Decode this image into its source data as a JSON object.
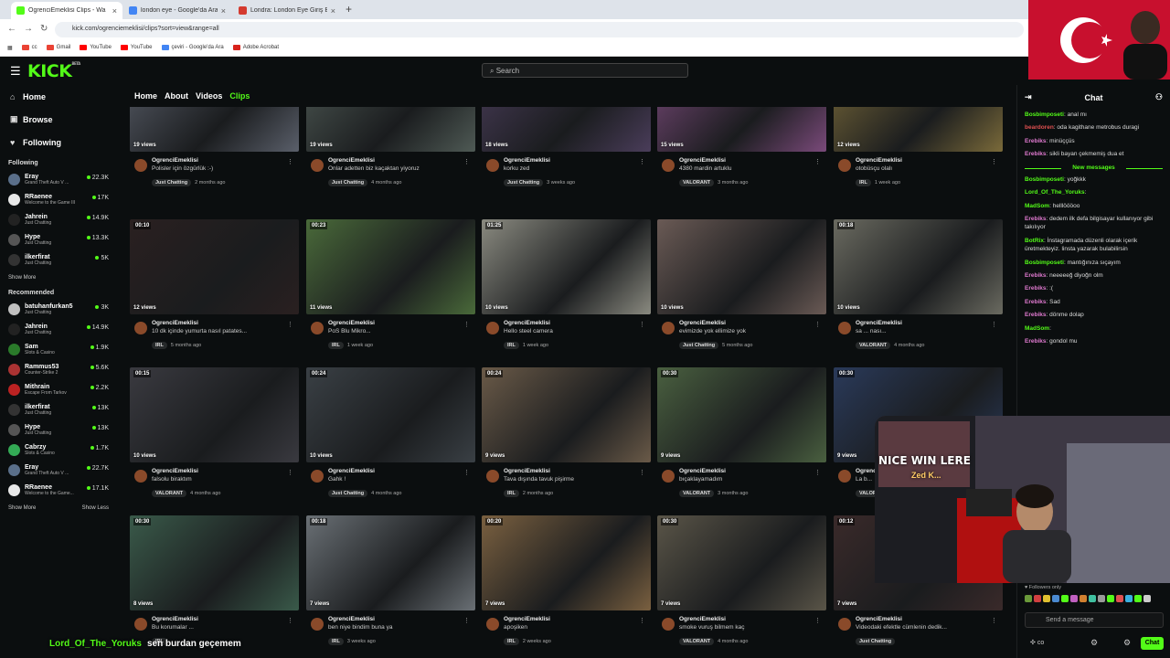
{
  "browser": {
    "tabs": [
      {
        "title": "OgrenciEmeklisi Clips - Wa",
        "color": "#53fc18",
        "active": true
      },
      {
        "title": "london eye - Google'da Ara",
        "color": "#4285f4",
        "active": false
      },
      {
        "title": "Londra: London Eye Giriş Bileti",
        "color": "#d43a2f",
        "active": false
      }
    ],
    "url": "kick.com/ogrenciemeklisi/clips?sort=view&range=all",
    "bookmarks": [
      {
        "label": "cc",
        "color": "#ea4335"
      },
      {
        "label": "Gmail",
        "color": "#ea4335"
      },
      {
        "label": "YouTube",
        "color": "#ff0000"
      },
      {
        "label": "YouTube",
        "color": "#ff0000"
      },
      {
        "label": "çeviri - Google'da Ara",
        "color": "#4285f4"
      },
      {
        "label": "Adobe Acrobat",
        "color": "#d8231c"
      }
    ]
  },
  "header": {
    "logo": "KICK",
    "logo_beta": "BETA",
    "search_placeholder": "Search"
  },
  "sidebar": {
    "nav": [
      {
        "icon": "⌂",
        "label": "Home"
      },
      {
        "icon": "▣",
        "label": "Browse"
      },
      {
        "icon": "♥",
        "label": "Following"
      }
    ],
    "following_title": "Following",
    "following": [
      {
        "name": "Eray",
        "game": "Grand Theft Auto V ...",
        "viewers": "22.3K",
        "color": "#5a6f8a"
      },
      {
        "name": "RRaenee",
        "game": "Welcome to the Game III",
        "viewers": "17K",
        "color": "#e8e8e8"
      },
      {
        "name": "Jahrein",
        "game": "Just Chatting",
        "viewers": "14.9K",
        "color": "#222"
      },
      {
        "name": "Hype",
        "game": "Just Chatting",
        "viewers": "13.3K",
        "color": "#555"
      },
      {
        "name": "ilkerfirat",
        "game": "Just Chatting",
        "viewers": "5K",
        "color": "#333"
      }
    ],
    "show_more": "Show More",
    "recommended_title": "Recommended",
    "recommended": [
      {
        "name": "batuhanfurkan5",
        "game": "Just Chatting",
        "viewers": "3K",
        "color": "#c0c0c0"
      },
      {
        "name": "Jahrein",
        "game": "Just Chatting",
        "viewers": "14.9K",
        "color": "#222"
      },
      {
        "name": "Sam",
        "game": "Slots & Casino",
        "viewers": "1.9K",
        "color": "#2a7a2a"
      },
      {
        "name": "Rammus53",
        "game": "Counter-Strike 2",
        "viewers": "5.6K",
        "color": "#a33"
      },
      {
        "name": "Mithrain",
        "game": "Escape From Tarkov",
        "viewers": "2.2K",
        "color": "#b22"
      },
      {
        "name": "ilkerfirat",
        "game": "Just Chatting",
        "viewers": "13K",
        "color": "#333"
      },
      {
        "name": "Hype",
        "game": "Just Chatting",
        "viewers": "13K",
        "color": "#555"
      },
      {
        "name": "Cabrzy",
        "game": "Slots & Casino",
        "viewers": "1.7K",
        "color": "#3a5"
      },
      {
        "name": "Eray",
        "game": "Grand Theft Auto V ...",
        "viewers": "22.7K",
        "color": "#5a6f8a"
      },
      {
        "name": "RRaenee",
        "game": "Welcome to the Game...",
        "viewers": "17.1K",
        "color": "#e8e8e8"
      }
    ],
    "show_more2": "Show More",
    "show_less": "Show Less"
  },
  "channel_tabs": [
    {
      "label": "Home",
      "active": false
    },
    {
      "label": "About",
      "active": false
    },
    {
      "label": "Videos",
      "active": false
    },
    {
      "label": "Clips",
      "active": true
    }
  ],
  "clips": [
    {
      "duration": "",
      "views": "19 views",
      "channel": "OgrenciEmeklisi",
      "title": "Polisler için özgürlük :-)",
      "tag": "Just Chatting",
      "age": "2 months ago",
      "thumb": "#5a5f6a"
    },
    {
      "duration": "",
      "views": "19 views",
      "channel": "OgrenciEmeklisi",
      "title": "Onlar adetten biz kaçaktan yiyoruz",
      "tag": "Just Chatting",
      "age": "4 months ago",
      "thumb": "#4f5a55"
    },
    {
      "duration": "",
      "views": "18 views",
      "channel": "OgrenciEmeklisi",
      "title": "korku zed",
      "tag": "Just Chatting",
      "age": "3 weeks ago",
      "thumb": "#4a3d5a"
    },
    {
      "duration": "",
      "views": "15 views",
      "channel": "OgrenciEmeklisi",
      "title": "4380 mardin artuklu",
      "tag": "VALORANT",
      "age": "3 months ago",
      "thumb": "#7a4a7a"
    },
    {
      "duration": "",
      "views": "12 views",
      "channel": "OgrenciEmeklisi",
      "title": "otobüsçu olalı",
      "tag": "IRL",
      "age": "1 week ago",
      "thumb": "#7a6a3a"
    },
    {
      "duration": "00:10",
      "views": "12 views",
      "channel": "OgrenciEmeklisi",
      "title": "10 dk içinde yumurta nasıl patates...",
      "tag": "IRL",
      "age": "5 months ago",
      "thumb": "#2a2020"
    },
    {
      "duration": "00:23",
      "views": "11 views",
      "channel": "OgrenciEmeklisi",
      "title": "PoS Blu Mikro...",
      "tag": "IRL",
      "age": "1 week ago",
      "thumb": "#4a6a3a"
    },
    {
      "duration": "01:25",
      "views": "10 views",
      "channel": "OgrenciEmeklisi",
      "title": "Hello steel camera",
      "tag": "IRL",
      "age": "1 week ago",
      "thumb": "#8a8a80"
    },
    {
      "duration": "",
      "views": "10 views",
      "channel": "OgrenciEmeklisi",
      "title": "evimizde yok ellimize yok",
      "tag": "Just Chatting",
      "age": "5 months ago",
      "thumb": "#6a5a55"
    },
    {
      "duration": "00:18",
      "views": "10 views",
      "channel": "OgrenciEmeklisi",
      "title": "sa ... nası...",
      "tag": "VALORANT",
      "age": "4 months ago",
      "thumb": "#6a6a60"
    },
    {
      "duration": "00:15",
      "views": "10 views",
      "channel": "OgrenciEmeklisi",
      "title": "falsolu biraktım",
      "tag": "VALORANT",
      "age": "4 months ago",
      "thumb": "#3a3a40"
    },
    {
      "duration": "00:24",
      "views": "10 views",
      "channel": "OgrenciEmeklisi",
      "title": "Gahk !",
      "tag": "Just Chatting",
      "age": "4 months ago",
      "thumb": "#3a4045"
    },
    {
      "duration": "00:24",
      "views": "9 views",
      "channel": "OgrenciEmeklisi",
      "title": "Tava dışında tavuk pişirme",
      "tag": "IRL",
      "age": "2 months ago",
      "thumb": "#6a5a48"
    },
    {
      "duration": "00:30",
      "views": "9 views",
      "channel": "OgrenciEmeklisi",
      "title": "bıçaklayamadım",
      "tag": "VALORANT",
      "age": "3 months ago",
      "thumb": "#4a6040"
    },
    {
      "duration": "00:30",
      "views": "9 views",
      "channel": "OgrenciEmeklisi",
      "title": "La b...",
      "tag": "VALORANT",
      "age": "",
      "thumb": "#2a3a5a"
    },
    {
      "duration": "00:30",
      "views": "8 views",
      "channel": "OgrenciEmeklisi",
      "title": "Bu korumalar ...",
      "tag": "IRL",
      "age": "",
      "thumb": "#3a5a4a"
    },
    {
      "duration": "00:18",
      "views": "7 views",
      "channel": "OgrenciEmeklisi",
      "title": "ben niye bindim buna ya",
      "tag": "IRL",
      "age": "3 weeks ago",
      "thumb": "#6a7075"
    },
    {
      "duration": "00:20",
      "views": "7 views",
      "channel": "OgrenciEmeklisi",
      "title": "apoşiken",
      "tag": "IRL",
      "age": "2 weeks ago",
      "thumb": "#7a6040"
    },
    {
      "duration": "00:30",
      "views": "7 views",
      "channel": "OgrenciEmeklisi",
      "title": "smoke vuruş bilmem kaç",
      "tag": "VALORANT",
      "age": "4 months ago",
      "thumb": "#5a5548"
    },
    {
      "duration": "00:12",
      "views": "7 views",
      "channel": "OgrenciEmeklisi",
      "title": "Videodaki efektle cümlenin dedik...",
      "tag": "Just Chatting",
      "age": "",
      "thumb": "#3a2a2a"
    }
  ],
  "chat": {
    "title": "Chat",
    "messages_before": [
      {
        "user": "Bosbimposeti",
        "color": "#53fc18",
        "text": "anal mı"
      },
      {
        "user": "beardoren",
        "color": "#e05050",
        "text": "oda kagithane metrobus duragi"
      },
      {
        "user": "Erebiks",
        "color": "#e07ad0",
        "text": "minüççüs"
      },
      {
        "user": "Erebiks",
        "color": "#e07ad0",
        "text": "sikli bayan çekmemiş dua et"
      }
    ],
    "new_messages": "New messages",
    "messages_after": [
      {
        "user": "Bosbimposeti",
        "color": "#53fc18",
        "text": "yoğkkk"
      },
      {
        "user": "Lord_Of_The_Yoruks",
        "color": "#53fc18",
        "text": ""
      },
      {
        "user": "MadSom",
        "color": "#53fc18",
        "text": "helllöööoo"
      },
      {
        "user": "Erebiks",
        "color": "#e07ad0",
        "text": "dedem ilk defa bilgisayar kullanıyor gibi takılıyor"
      },
      {
        "user": "BotRix",
        "color": "#53fc18",
        "text": "İnstagramada düzenli olarak içerik üretmekteyiz. linsta yazarak bulabilirsin"
      },
      {
        "user": "Bosbimposeti",
        "color": "#53fc18",
        "text": "mantığınıza sıçayım"
      },
      {
        "user": "Erebiks",
        "color": "#e07ad0",
        "text": "neeeeeğ diyoğn olm"
      },
      {
        "user": "Erebiks",
        "color": "#e07ad0",
        "text": ":("
      },
      {
        "user": "Erebiks",
        "color": "#e07ad0",
        "text": "Sad"
      },
      {
        "user": "Erebiks",
        "color": "#e07ad0",
        "text": "dönme dolap"
      },
      {
        "user": "MadSom",
        "color": "#53fc18",
        "text": ""
      },
      {
        "user": "Erebiks",
        "color": "#e07ad0",
        "text": "gondol mu"
      }
    ],
    "followers_only": "Followers only",
    "send_placeholder": "Send a message",
    "chat_button": "Chat",
    "points": "co"
  },
  "overlay": {
    "caption_user": "Lord_Of_The_Yoruks",
    "caption_text": "sen burdan geçemem",
    "webcam_sign": "NICE WIN LERE",
    "webcam_sign_sub": "Zed K..."
  },
  "colors": {
    "accent": "#53fc18",
    "bg": "#0b0e0f"
  }
}
